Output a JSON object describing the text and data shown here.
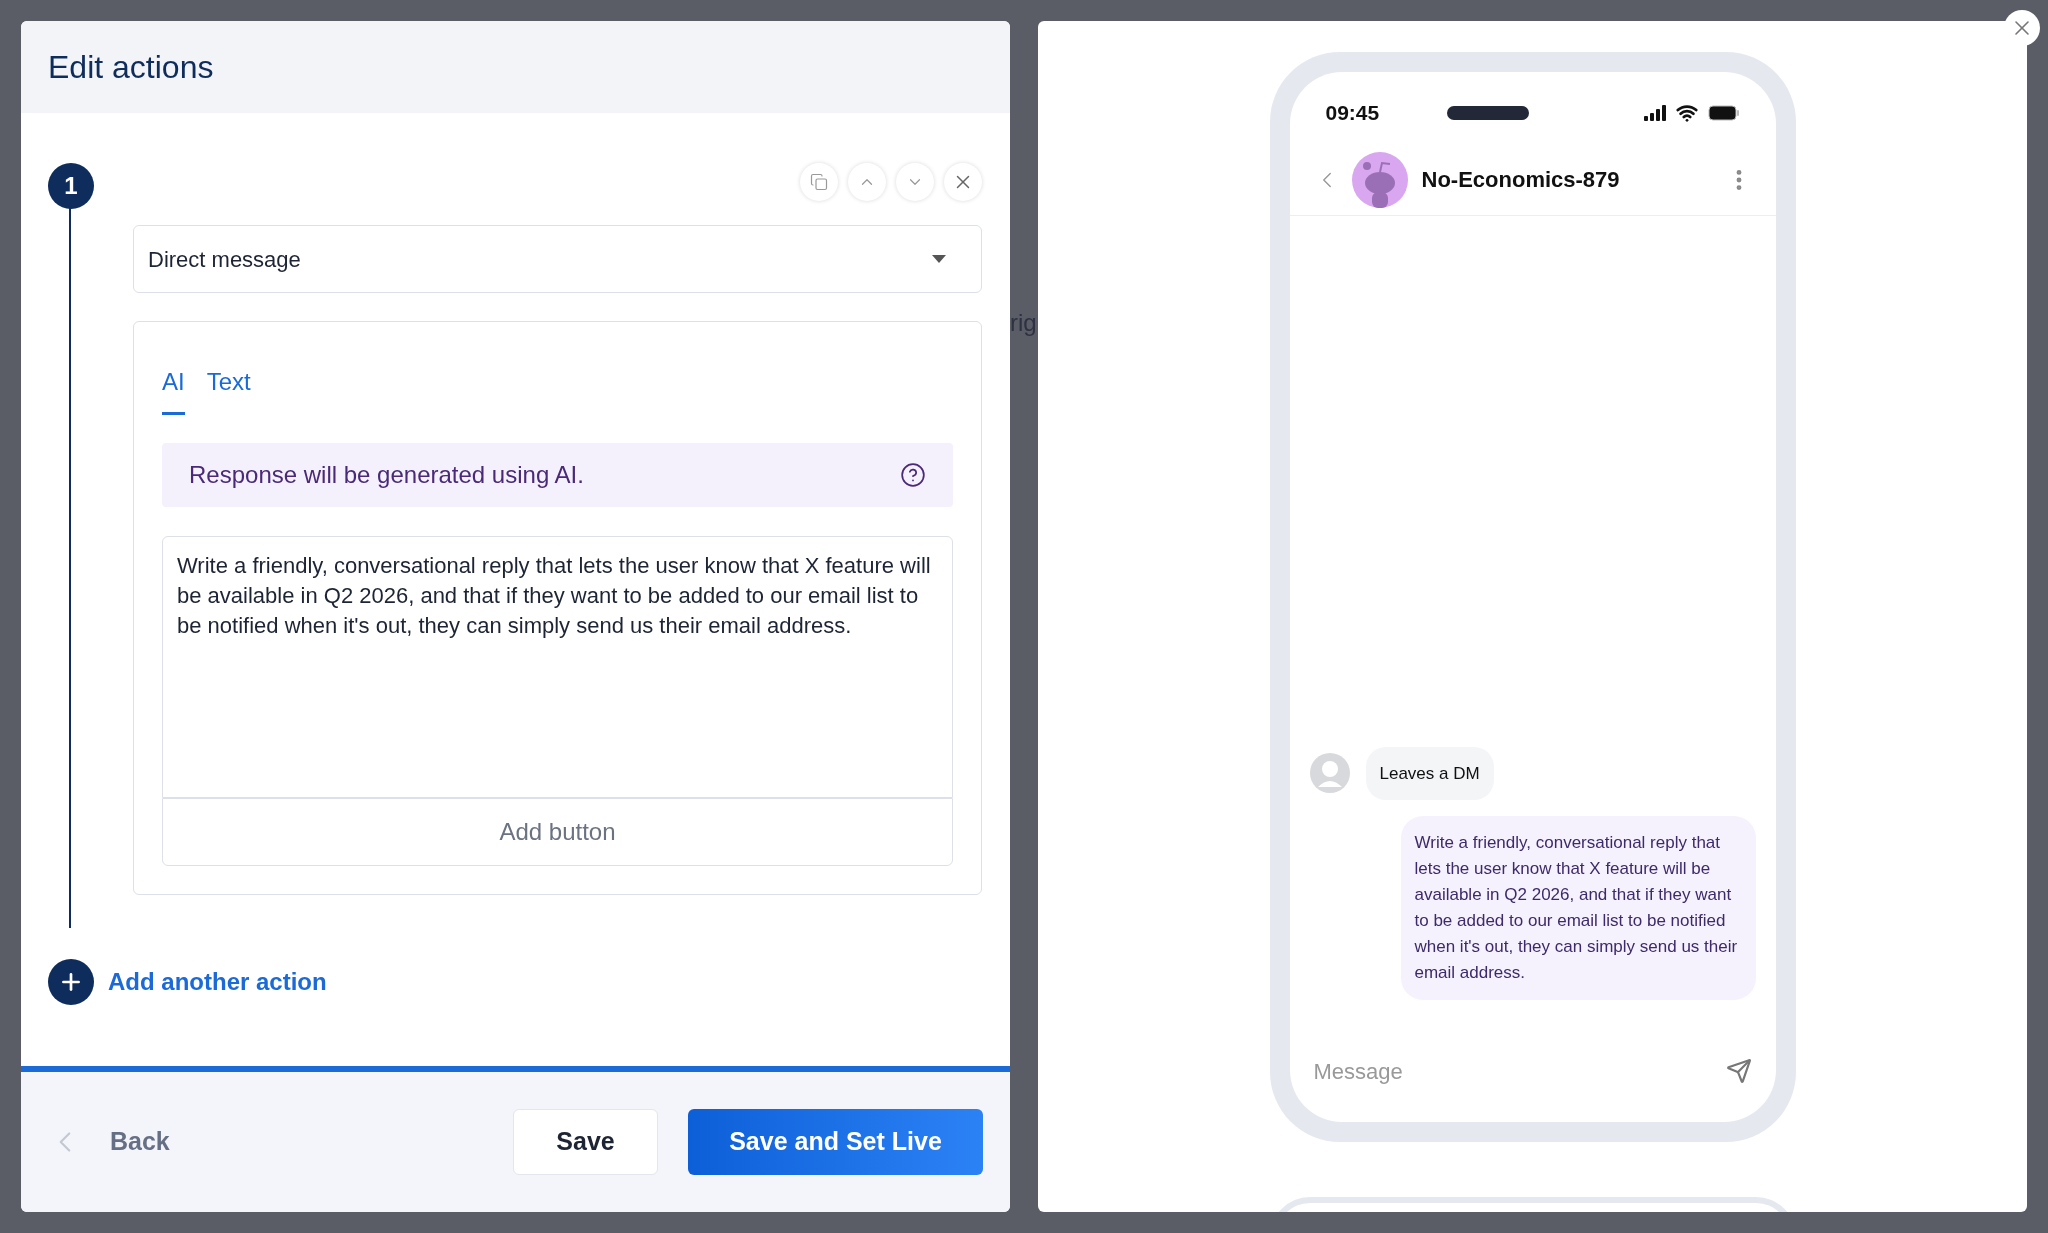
{
  "background": {
    "fragments": [
      "rig"
    ]
  },
  "editor": {
    "title": "Edit actions",
    "step": {
      "number": "1",
      "action_type": "Direct message",
      "tabs": [
        {
          "label": "AI",
          "selected": true
        },
        {
          "label": "Text",
          "selected": false
        }
      ],
      "info": "Response will be generated using AI.",
      "prompt": "Write a friendly, conversational reply that lets the user know that X feature will be available in Q2 2026, and that if they want to be added to our email list to be notified when it's out, they can simply send us their email address.",
      "add_button": "Add button"
    },
    "add_action": "Add another action",
    "footer": {
      "back": "Back",
      "save": "Save",
      "save_live": "Save and Set Live"
    }
  },
  "preview": {
    "time": "09:45",
    "contact": "No-Economics-879",
    "messages": [
      {
        "kind": "incoming",
        "text": "Leaves a DM"
      },
      {
        "kind": "outgoing",
        "text": "Write a friendly, conversational reply that lets the user know that X feature will be available in Q2 2026, and that if they want to be added to our email list to be notified when it's out, they can simply send us their email address."
      }
    ],
    "input_placeholder": "Message"
  }
}
